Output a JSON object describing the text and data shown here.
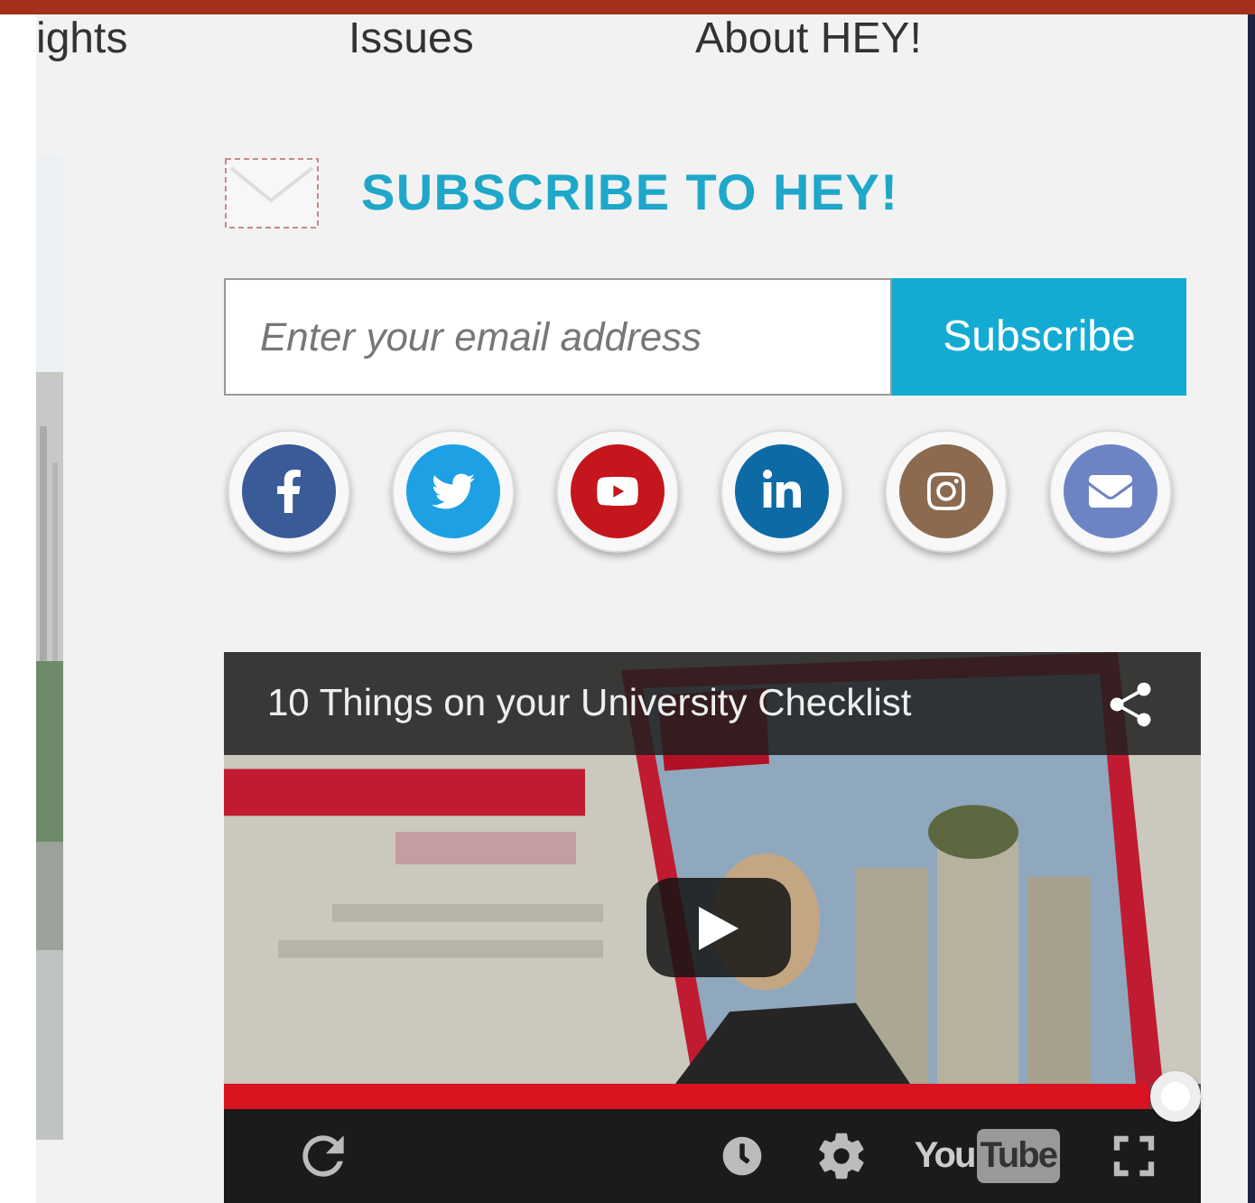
{
  "nav": {
    "items": [
      {
        "label": "ights"
      },
      {
        "label": "Issues"
      },
      {
        "label": "About HEY!"
      }
    ]
  },
  "subscribe": {
    "title": "SUBSCRIBE TO HEY!",
    "email_field": {
      "placeholder": "Enter your email address"
    },
    "button": "Subscribe"
  },
  "social": [
    {
      "kind": "facebook",
      "color": "#3a5a98"
    },
    {
      "kind": "twitter",
      "color": "#1ea1e4"
    },
    {
      "kind": "youtube",
      "color": "#c4161c"
    },
    {
      "kind": "linkedin",
      "color": "#0e6aa5"
    },
    {
      "kind": "instagram",
      "color": "#8b6a4f"
    },
    {
      "kind": "email",
      "color": "#6d84c4"
    }
  ],
  "video": {
    "title": "10 Things on your University Checklist",
    "progress": {
      "level": 1
    },
    "logo": [
      "You",
      "Tube"
    ]
  }
}
